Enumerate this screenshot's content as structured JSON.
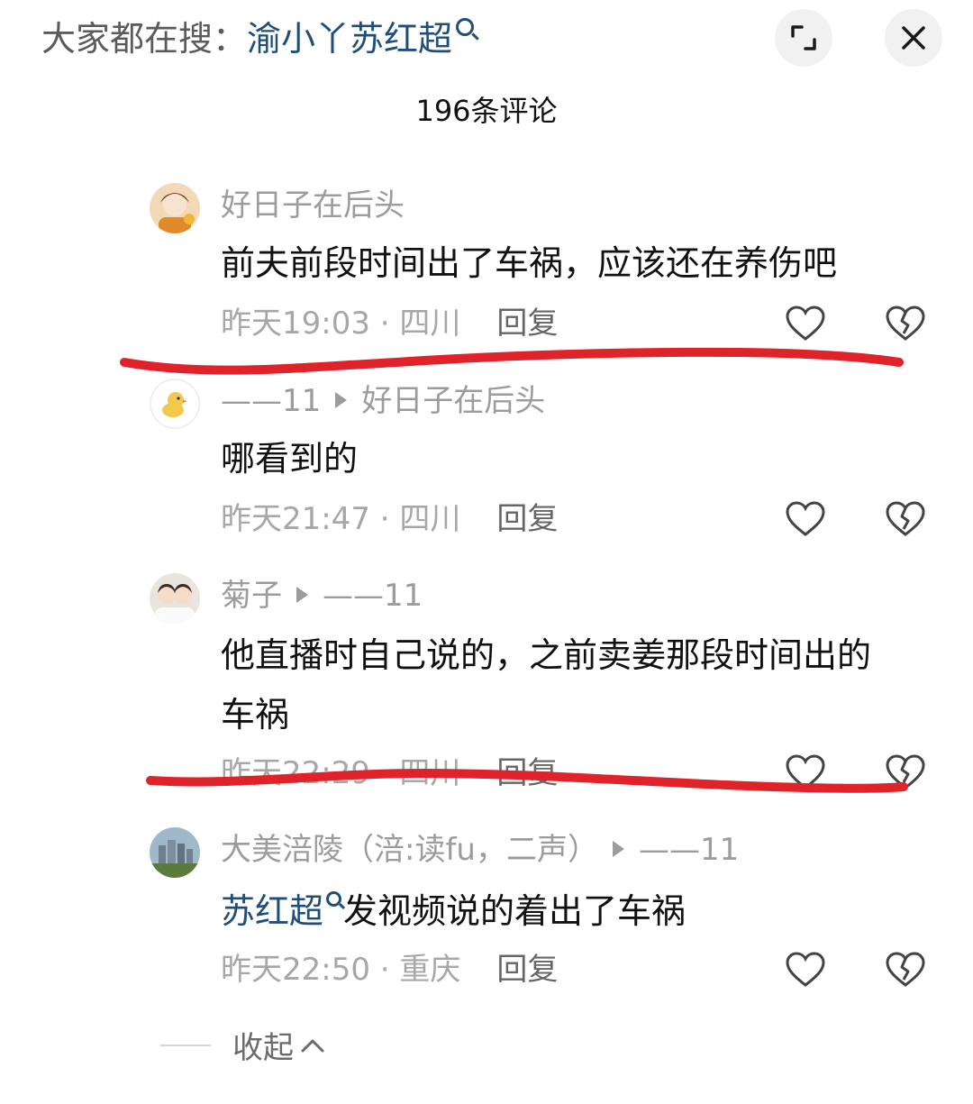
{
  "header": {
    "search_prefix": "大家都在搜：",
    "search_keyword": "渝小丫苏红超",
    "expand_icon": "expand-icon",
    "close_icon": "close-icon"
  },
  "comment_count": "196条评论",
  "comments": [
    {
      "author": "好日子在后头",
      "reply_to": "",
      "text": "前夫前段时间出了车祸，应该还在养伤吧",
      "time": "昨天19:03",
      "location": "四川",
      "reply_label": "回复"
    },
    {
      "author": "——11",
      "reply_to": "好日子在后头",
      "text": "哪看到的",
      "time": "昨天21:47",
      "location": "四川",
      "reply_label": "回复"
    },
    {
      "author": "菊子",
      "reply_to": "——11",
      "text_line1": "他直播时自己说的，之前卖姜那段时间出的",
      "text_line2": "车祸",
      "time": "昨天22:29",
      "location": "四川",
      "reply_label": "回复"
    },
    {
      "author": "大美涪陵（涪:读fu，二声）",
      "reply_to": "——11",
      "text_keyword": "苏红超",
      "text_rest": "发视频说的着出了车祸",
      "time": "昨天22:50",
      "location": "重庆",
      "reply_label": "回复"
    }
  ],
  "collapse_label": "收起",
  "colors": {
    "accent_link": "#1f4e79",
    "annotation_red": "#e0222a",
    "muted_text": "#9c9c9c"
  }
}
